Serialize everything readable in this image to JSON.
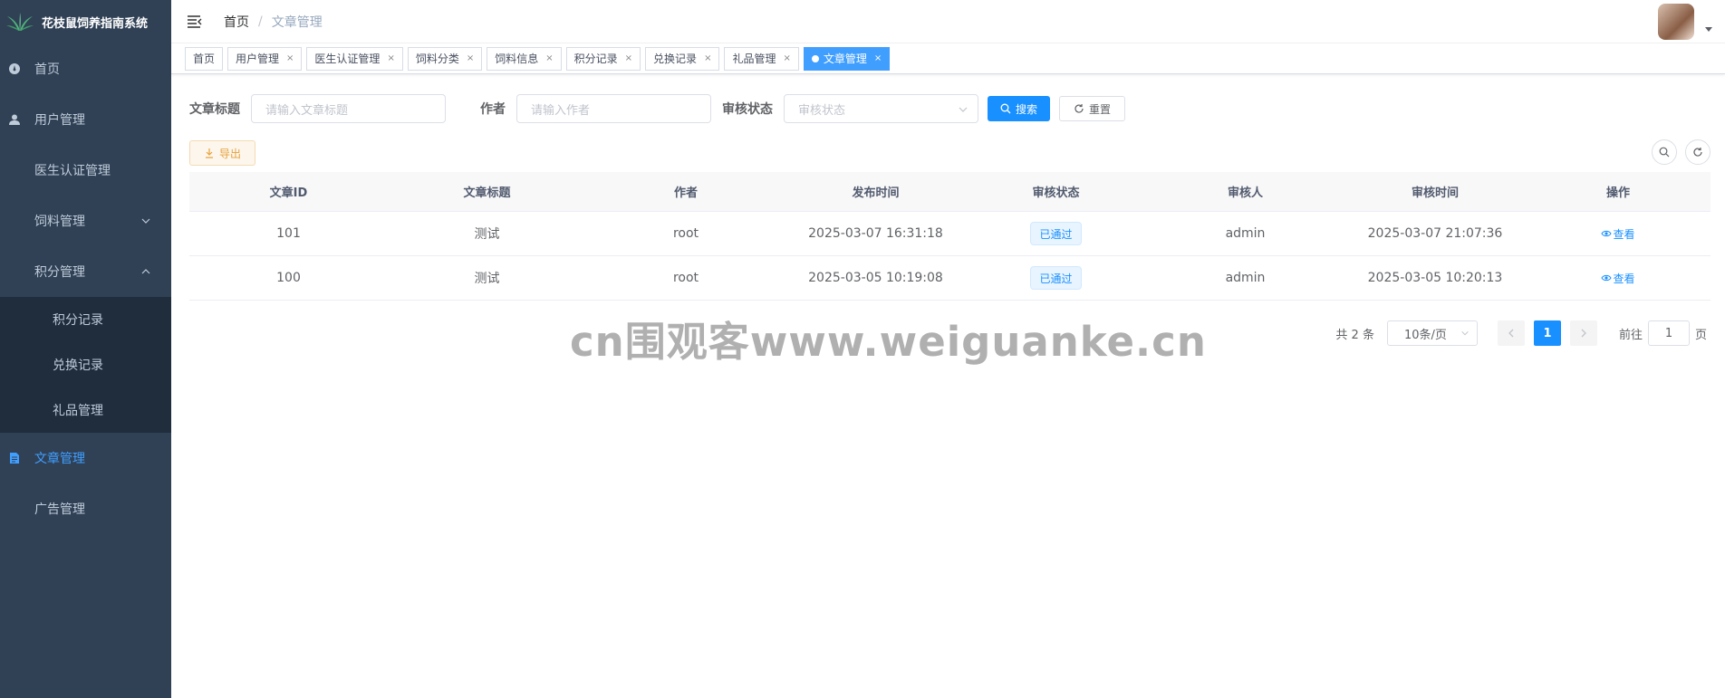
{
  "app": {
    "title": "花枝鼠饲养指南系统"
  },
  "sidebar": {
    "items": [
      {
        "label": "首页",
        "icon": "dashboard-icon"
      },
      {
        "label": "用户管理",
        "icon": "user-icon"
      },
      {
        "label": "医生认证管理"
      },
      {
        "label": "饲料管理"
      },
      {
        "label": "积分管理"
      },
      {
        "label": "文章管理",
        "icon": "document-icon"
      },
      {
        "label": "广告管理"
      }
    ],
    "points_submenu": [
      "积分记录",
      "兑换记录",
      "礼品管理"
    ]
  },
  "breadcrumb": {
    "home": "首页",
    "separator": "/",
    "current": "文章管理"
  },
  "tags": [
    {
      "label": "首页"
    },
    {
      "label": "用户管理"
    },
    {
      "label": "医生认证管理"
    },
    {
      "label": "饲料分类"
    },
    {
      "label": "饲料信息"
    },
    {
      "label": "积分记录"
    },
    {
      "label": "兑换记录"
    },
    {
      "label": "礼品管理"
    },
    {
      "label": "文章管理"
    }
  ],
  "tag_close": "×",
  "search": {
    "title_label": "文章标题",
    "title_placeholder": "请输入文章标题",
    "author_label": "作者",
    "author_placeholder": "请输入作者",
    "status_label": "审核状态",
    "status_placeholder": "审核状态",
    "search_button": "搜索",
    "reset_button": "重置"
  },
  "toolbar": {
    "export_button": "导出"
  },
  "table": {
    "columns": [
      "文章ID",
      "文章标题",
      "作者",
      "发布时间",
      "审核状态",
      "审核人",
      "审核时间",
      "操作"
    ],
    "rows": [
      {
        "id": "101",
        "title": "测试",
        "author": "root",
        "publish_time": "2025-03-07 16:31:18",
        "status": "已通过",
        "reviewer": "admin",
        "review_time": "2025-03-07 21:07:36",
        "action": "查看"
      },
      {
        "id": "100",
        "title": "测试",
        "author": "root",
        "publish_time": "2025-03-05 10:19:08",
        "status": "已通过",
        "reviewer": "admin",
        "review_time": "2025-03-05 10:20:13",
        "action": "查看"
      }
    ]
  },
  "pagination": {
    "total": "共 2 条",
    "page_size": "10条/页",
    "current_page": "1",
    "goto_label": "前往",
    "goto_value": "1",
    "page_unit": "页"
  },
  "watermark": "cn围观客www.weiguanke.cn",
  "colors": {
    "sidebar_bg": "#304156",
    "submenu_bg": "#1f2d3d",
    "primary": "#1890ff",
    "active_menu": "#409eff"
  }
}
